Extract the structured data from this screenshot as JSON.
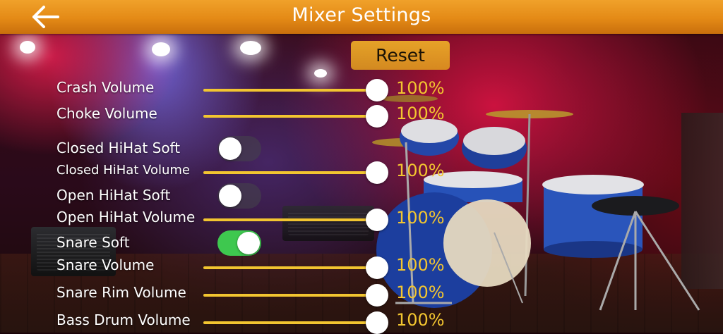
{
  "header": {
    "title": "Mixer Settings",
    "back_icon": "back-arrow-icon"
  },
  "reset_label": "Reset",
  "colors": {
    "header": "#e48a16",
    "accent": "#f2c530",
    "toggle_on": "#3ec84f"
  },
  "settings": {
    "crash_volume": {
      "label": "Crash Volume",
      "value": "100%",
      "level": 1.0
    },
    "choke_volume": {
      "label": "Choke Volume",
      "value": "100%",
      "level": 1.0
    },
    "closed_hihat_soft": {
      "label": "Closed HiHat Soft",
      "on": false
    },
    "closed_hihat_volume": {
      "label": "Closed HiHat Volume",
      "value": "100%",
      "level": 1.0
    },
    "open_hihat_soft": {
      "label": "Open HiHat Soft",
      "on": false
    },
    "open_hihat_volume": {
      "label": "Open HiHat Volume",
      "value": "100%",
      "level": 1.0
    },
    "snare_soft": {
      "label": "Snare Soft",
      "on": true
    },
    "snare_volume": {
      "label": "Snare Volume",
      "value": "100%",
      "level": 1.0
    },
    "snare_rim_volume": {
      "label": "Snare Rim Volume",
      "value": "100%",
      "level": 1.0
    },
    "bass_drum_volume": {
      "label": "Bass Drum Volume",
      "value": "100%",
      "level": 1.0
    }
  }
}
